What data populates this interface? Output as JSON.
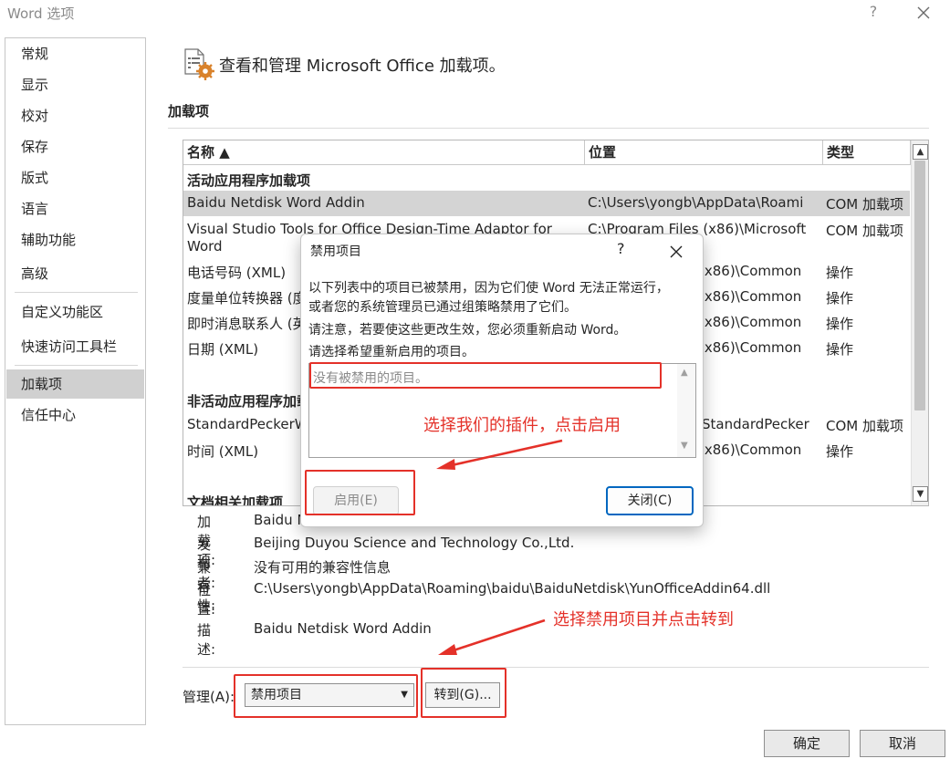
{
  "window": {
    "title": "Word 选项",
    "help": "?"
  },
  "nav": {
    "items": [
      {
        "label": "常规"
      },
      {
        "label": "显示"
      },
      {
        "label": "校对"
      },
      {
        "label": "保存"
      },
      {
        "label": "版式"
      },
      {
        "label": "语言"
      },
      {
        "label": "辅助功能"
      },
      {
        "label": "高级"
      },
      {
        "label": "自定义功能区"
      },
      {
        "label": "快速访问工具栏"
      },
      {
        "label": "加载项",
        "selected": true
      },
      {
        "label": "信任中心"
      }
    ]
  },
  "main": {
    "heading": "查看和管理 Microsoft Office 加载项。",
    "section_title": "加载项",
    "columns": {
      "name": "名称 ▲",
      "location": "位置",
      "type": "类型"
    },
    "groups": {
      "active": "活动应用程序加载项",
      "inactive": "非活动应用程序加载",
      "document": "文档相关加载项"
    },
    "rows": [
      {
        "name": "Baidu Netdisk Word Addin",
        "location": "C:\\Users\\yongb\\AppData\\Roami",
        "type": "COM 加载项",
        "selected": true
      },
      {
        "name": "Visual Studio Tools for Office Design-Time Adaptor for",
        "name2": "Word",
        "location": "C:\\Program Files (x86)\\Microsoft",
        "type": "COM 加载项"
      },
      {
        "name": "电话号码 (XML)",
        "location": "(x86)\\Common",
        "type": "操作"
      },
      {
        "name": "度量单位转换器 (度",
        "location": "(x86)\\Common",
        "type": "操作"
      },
      {
        "name": "即时消息联系人 (英",
        "location": "(x86)\\Common",
        "type": "操作"
      },
      {
        "name": "日期 (XML)",
        "location": "(x86)\\Common",
        "type": "操作"
      },
      {
        "name": "StandardPeckerW",
        "location": "StandardPecker",
        "type": "COM 加载项"
      },
      {
        "name": "时间 (XML)",
        "location": "(x86)\\Common",
        "type": "操作"
      }
    ],
    "details": {
      "addin_label": "加载项:",
      "addin_value": "Baidu N",
      "publisher_label": "发布者:",
      "publisher_value": "Beijing Duyou Science and Technology Co.,Ltd.",
      "compat_label": "兼容性:",
      "compat_value": "没有可用的兼容性信息",
      "location_label": "位置:",
      "location_value": "C:\\Users\\yongb\\AppData\\Roaming\\baidu\\BaiduNetdisk\\YunOfficeAddin64.dll",
      "desc_label": "描述:",
      "desc_value": "Baidu Netdisk Word Addin"
    },
    "manage_label": "管理(A):",
    "manage_selected": "禁用项目",
    "go_button": "转到(G)..."
  },
  "footer": {
    "ok": "确定",
    "cancel": "取消"
  },
  "dialog": {
    "title": "禁用项目",
    "help": "?",
    "line1": "以下列表中的项目已被禁用，因为它们使 Word 无法正常运行，",
    "line2": "或者您的系统管理员已通过组策略禁用了它们。",
    "line3": "请注意，若要使这些更改生效，您必须重新启动 Word。",
    "line4": "请选择希望重新启用的项目。",
    "list_empty": "没有被禁用的项目。",
    "enable_button": "启用(E)",
    "close_button": "关闭(C)"
  },
  "annotations": {
    "note1": "选择我们的插件，点击启用",
    "note2": "选择禁用项目并点击转到",
    "color": "#e43129"
  }
}
